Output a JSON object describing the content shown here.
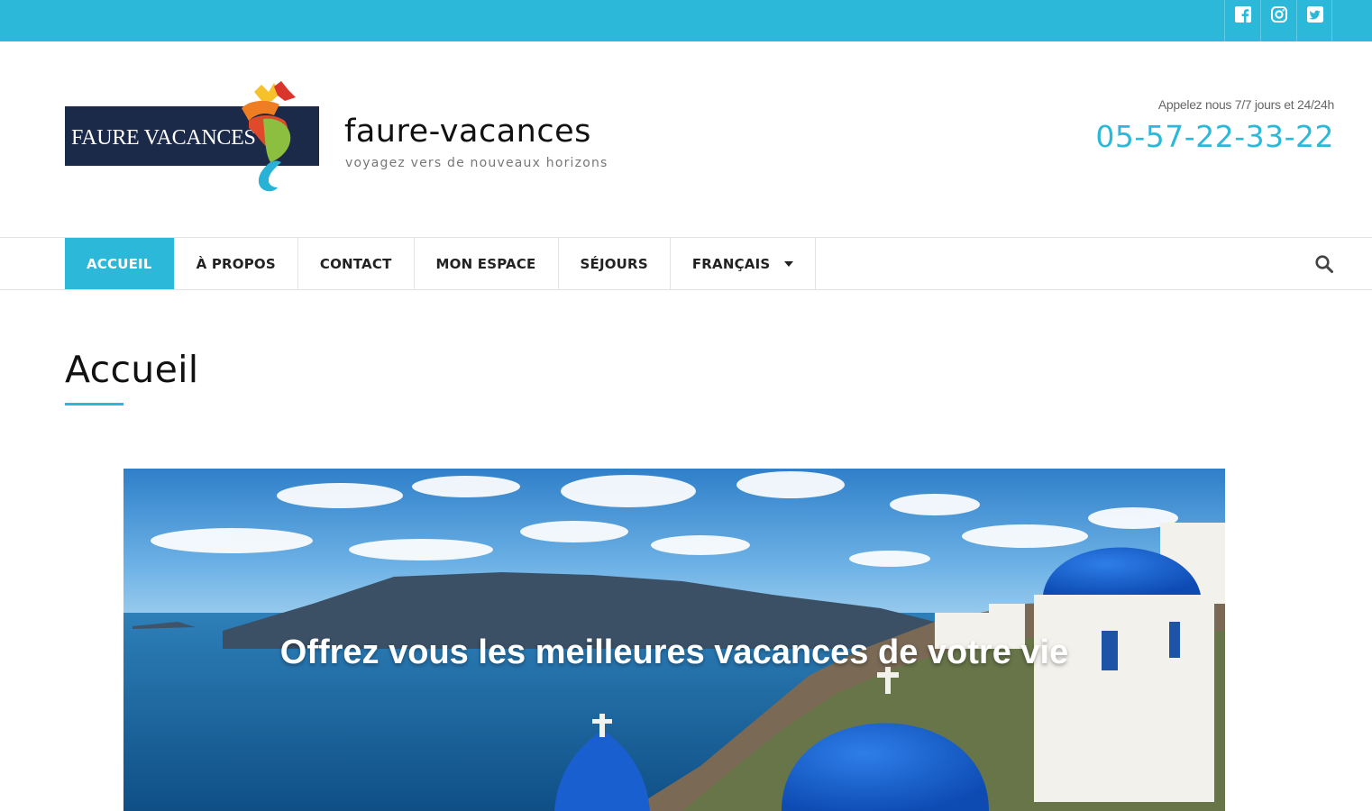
{
  "topbar": {
    "bg_color": "#2cb8d9",
    "social": [
      {
        "name": "facebook",
        "icon": "facebook-icon"
      },
      {
        "name": "instagram",
        "icon": "instagram-icon"
      },
      {
        "name": "twitter",
        "icon": "twitter-icon"
      }
    ]
  },
  "header": {
    "logo_text": "FAURE VACANCES",
    "site_title": "faure-vacances",
    "tagline": "voyagez vers de nouveaux horizons",
    "call_label": "Appelez nous 7/7 jours et 24/24h",
    "phone": "05-57-22-33-22",
    "accent_color": "#2cb8d9"
  },
  "nav": {
    "items": [
      {
        "label": "ACCUEIL",
        "active": true
      },
      {
        "label": "À PROPOS",
        "active": false
      },
      {
        "label": "CONTACT",
        "active": false
      },
      {
        "label": "MON ESPACE",
        "active": false
      },
      {
        "label": "SÉJOURS",
        "active": false
      },
      {
        "label": "FRANÇAIS",
        "active": false,
        "dropdown": true
      }
    ],
    "search_icon": "search-icon"
  },
  "page": {
    "title": "Accueil"
  },
  "hero": {
    "headline": "Offrez vous les meilleures vacances de votre vie"
  }
}
